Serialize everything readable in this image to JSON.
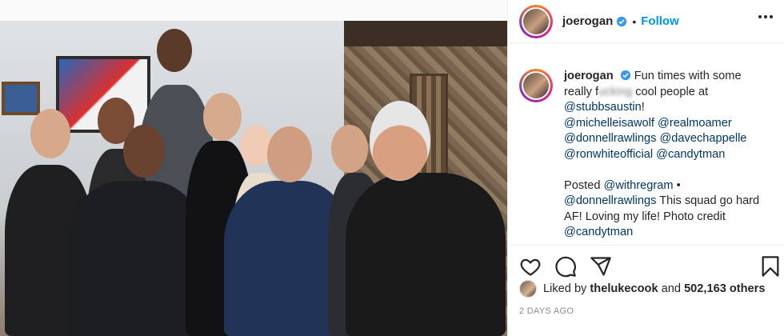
{
  "post": {
    "username": "joerogan",
    "follow_label": "Follow",
    "caption": {
      "username": "joerogan",
      "text_before_blur": "Fun times with some really",
      "blurred_start": "f",
      "blurred_word": "ucking",
      "text_after_blur": " cool people at ",
      "tags_line1": [
        "@stubbsaustin",
        "!"
      ],
      "mentions": [
        "@michelleisawolf",
        "@realmoamer",
        "@donnellrawlings",
        "@davechappelle",
        "@ronwhiteofficial",
        "@candytman"
      ],
      "posted_label": "Posted",
      "posted_by": "@withregram",
      "posted_sep": "•",
      "posted_mention": "@donnellrawlings",
      "posted_text": "This squad go hard AF! Loving my life! Photo credit",
      "credit": "@candytman",
      "age": "2d"
    },
    "likes": {
      "prefix": "Liked by",
      "liker": "thelukecook",
      "connector": "and",
      "count": "502,163 others"
    },
    "date": "2 DAYS AGO"
  },
  "icons": [
    "verified-badge-icon",
    "more-options-icon",
    "heart-icon",
    "comment-icon",
    "share-icon",
    "bookmark-icon"
  ],
  "colors": {
    "follow": "#0095f6",
    "mention": "#00376b",
    "muted": "#8e8e8e",
    "verified": "#3897f0"
  }
}
